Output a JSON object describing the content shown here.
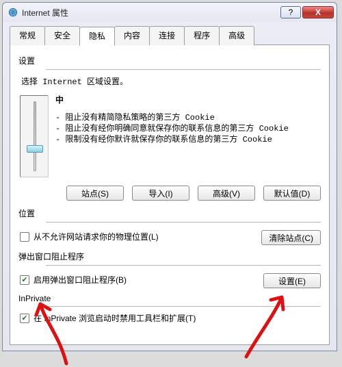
{
  "window": {
    "title": "Internet 属性",
    "help_symbol": "?",
    "close_symbol": "X"
  },
  "tabs": [
    "常规",
    "安全",
    "隐私",
    "内容",
    "连接",
    "程序",
    "高级"
  ],
  "active_tab_index": 2,
  "settings": {
    "label": "设置",
    "zone_text": "选择 Internet 区域设置。",
    "level_name": "中",
    "bullets": [
      "阻止没有精简隐私策略的第三方 Cookie",
      "阻止没有经你明确同意就保存你的联系信息的第三方 Cookie",
      "限制没有经你默许就保存你的联系信息的第三方 Cookie"
    ],
    "buttons": {
      "sites": "站点(S)",
      "import": "导入(I)",
      "advanced": "高级(V)",
      "default": "默认值(D)"
    }
  },
  "location": {
    "label": "位置",
    "checkbox_label": "从不允许网站请求你的物理位置(L)",
    "checked": false,
    "clear_button": "清除站点(C)"
  },
  "popup": {
    "label": "弹出窗口阻止程序",
    "checkbox_label": "启用弹出窗口阻止程序(B)",
    "checked": true,
    "settings_button": "设置(E)"
  },
  "inprivate": {
    "label": "InPrivate",
    "checkbox_label": "在 InPrivate 浏览启动时禁用工具栏和扩展(T)",
    "checked": true
  }
}
